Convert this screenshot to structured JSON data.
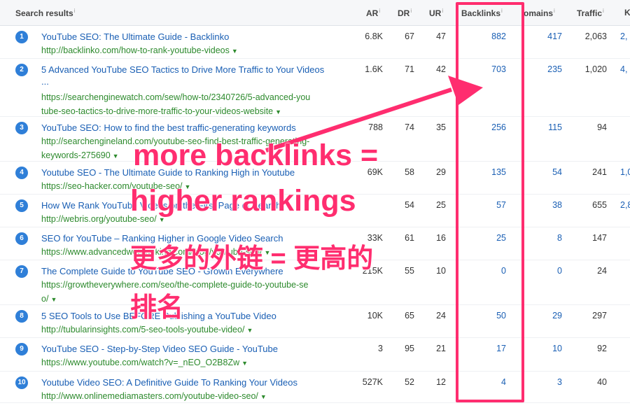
{
  "header": {
    "search_results": "Search results",
    "ar": "AR",
    "dr": "DR",
    "ur": "UR",
    "backlinks": "Backlinks",
    "domains": "omains",
    "traffic": "Traffic",
    "k": "K",
    "info": "i"
  },
  "rows": [
    {
      "num": "1",
      "title": "YouTube SEO: The Ultimate Guide - Backlinko",
      "url1": "http://backlinko.com/how-to-rank-youtube-videos",
      "url2": "",
      "url3": "",
      "ar": "6.8K",
      "dr": "67",
      "ur": "47",
      "backlinks": "882",
      "domains": "417",
      "traffic": "2,063",
      "k": "2,"
    },
    {
      "num": "2",
      "title": "5 Advanced YouTube SEO Tactics to Drive More Traffic to Your Videos",
      "title2": "...",
      "url1": "https://searchenginewatch.com/sew/how-to/2340726/5-advanced-you",
      "url2": "tube-seo-tactics-to-drive-more-traffic-to-your-videos-website",
      "url3": "",
      "ar": "1.6K",
      "dr": "71",
      "ur": "42",
      "backlinks": "703",
      "domains": "235",
      "traffic": "1,020",
      "k": "4,"
    },
    {
      "num": "3",
      "title": "YouTube SEO: How to find the best traffic-generating keywords",
      "url1": "http://searchengineland.com/youtube-seo-find-best-traffic-generating-",
      "url2": "keywords-275690",
      "url3": "",
      "ar": "788",
      "dr": "74",
      "ur": "35",
      "backlinks": "256",
      "domains": "115",
      "traffic": "94",
      "k": ""
    },
    {
      "num": "4",
      "title": "Youtube SEO - The Ultimate Guide to Ranking High in Youtube",
      "url1": "https://seo-hacker.com/youtube-seo/",
      "url2": "",
      "url3": "",
      "ar": "69K",
      "dr": "58",
      "ur": "29",
      "backlinks": "135",
      "domains": "54",
      "traffic": "241",
      "k": "1,0"
    },
    {
      "num": "5",
      "title": "How We Rank YouTube Videos on the First Page of Search",
      "url1": "http://webris.org/youtube-seo/",
      "url2": "",
      "url3": "",
      "ar": "",
      "dr": "54",
      "ur": "25",
      "backlinks": "57",
      "domains": "38",
      "traffic": "655",
      "k": "2,8"
    },
    {
      "num": "6",
      "title": "SEO for YouTube – Ranking Higher in Google Video Search",
      "url1": "https://www.advancedwebranking.com/blog/youtube-seo/",
      "url2": "",
      "url3": "",
      "ar": "33K",
      "dr": "61",
      "ur": "16",
      "backlinks": "25",
      "domains": "8",
      "traffic": "147",
      "k": ""
    },
    {
      "num": "7",
      "title": "The Complete Guide to YouTube SEO - Growth Everywhere",
      "url1": "https://growtheverywhere.com/seo/the-complete-guide-to-youtube-se",
      "url2": "o/",
      "url3": "",
      "ar": "215K",
      "dr": "55",
      "ur": "10",
      "backlinks": "0",
      "domains": "0",
      "traffic": "24",
      "k": ""
    },
    {
      "num": "8",
      "title": "5 SEO Tools to Use BEFORE Publishing a YouTube Video",
      "url1": "http://tubularinsights.com/5-seo-tools-youtube-video/",
      "url2": "",
      "url3": "",
      "ar": "10K",
      "dr": "65",
      "ur": "24",
      "backlinks": "50",
      "domains": "29",
      "traffic": "297",
      "k": ""
    },
    {
      "num": "9",
      "title": "YouTube SEO - Step-by-Step Video SEO Guide - YouTube",
      "url1": "https://www.youtube.com/watch?v=_nEO_O2B8Zw",
      "url2": "",
      "url3": "",
      "ar": "3",
      "dr": "95",
      "ur": "21",
      "backlinks": "17",
      "domains": "10",
      "traffic": "92",
      "k": ""
    },
    {
      "num": "10",
      "title": "Youtube Video SEO: A Definitive Guide To Ranking Your Videos",
      "url1": "http://www.onlinemediamasters.com/youtube-video-seo/",
      "url2": "",
      "url3": "",
      "ar": "527K",
      "dr": "52",
      "ur": "12",
      "backlinks": "4",
      "domains": "3",
      "traffic": "40",
      "k": ""
    }
  ],
  "overlay": {
    "line1": "more backlinks =",
    "line2": "higher rankings",
    "line3": "更多的外链 = 更高的",
    "line4": "排名"
  },
  "colors": {
    "highlight": "#ff2d6f",
    "link": "#1a5fb4",
    "url": "#2d8a2d",
    "badge": "#2f7fd8"
  }
}
